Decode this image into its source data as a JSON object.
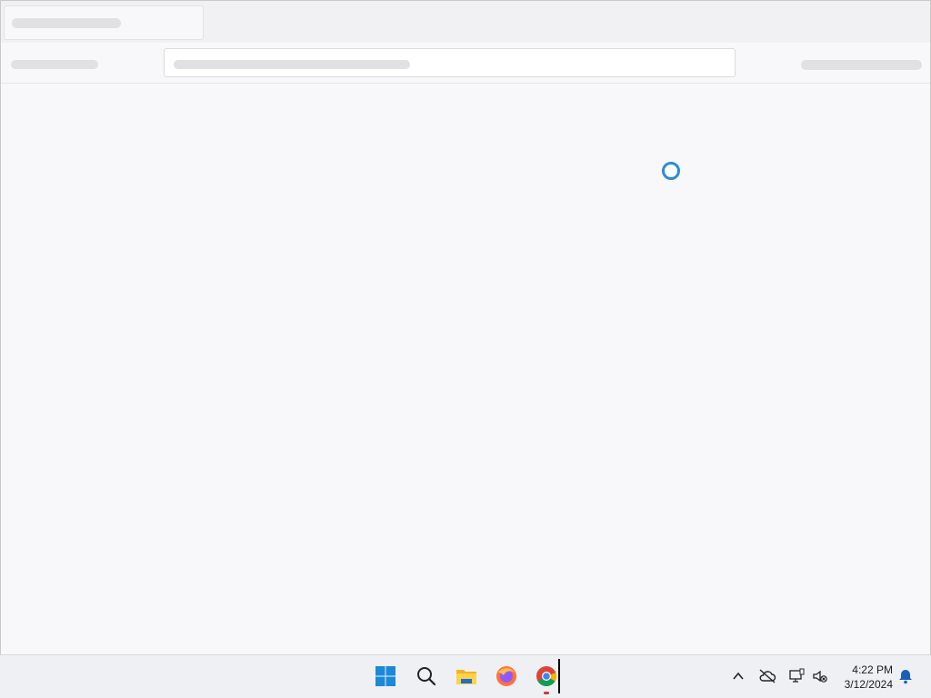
{
  "taskbar": {
    "apps": [
      {
        "name": "start",
        "icon": "windows-start-icon"
      },
      {
        "name": "search",
        "icon": "search-icon"
      },
      {
        "name": "file-explorer",
        "icon": "folder-icon"
      },
      {
        "name": "firefox",
        "icon": "firefox-icon"
      },
      {
        "name": "chrome",
        "icon": "chrome-icon",
        "active": true
      }
    ],
    "tray": {
      "icons": [
        "chevron-up-icon",
        "cloud-off-icon",
        "network-icon",
        "volume-muted-icon",
        "notification-bell-icon"
      ],
      "time": "4:22 PM",
      "date": "3/12/2024"
    }
  },
  "colors": {
    "accent": "#2d8bd8",
    "skeleton": "#e1e1e4",
    "active_indicator": "#d13438"
  }
}
